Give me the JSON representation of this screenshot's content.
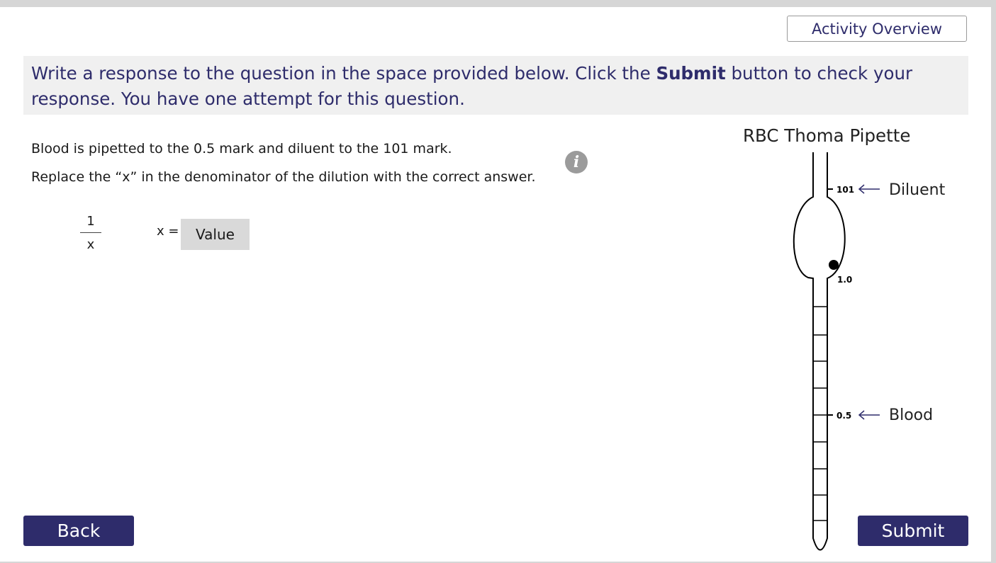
{
  "header": {
    "overview_label": "Activity Overview"
  },
  "instructions": {
    "before": "Write a response to the question in the space provided below. Click the ",
    "bold": "Submit",
    "after": " button to check your response. You have one attempt for this question."
  },
  "question": {
    "line1": "Blood is pipetted to the 0.5 mark and diluent to the 101 mark.",
    "line2": "Replace the “x” in the denominator of the dilution with the correct answer."
  },
  "fraction": {
    "numerator": "1",
    "denominator": "x"
  },
  "answer": {
    "label": "x =",
    "placeholder": "Value",
    "value": ""
  },
  "info_icon": {
    "glyph": "i",
    "icon": "info-icon"
  },
  "pipette": {
    "title": "RBC Thoma Pipette",
    "mark_101": "101",
    "mark_1_0": "1.0",
    "mark_0_5": "0.5",
    "diluent_label": "Diluent",
    "blood_label": "Blood"
  },
  "nav": {
    "back_label": "Back",
    "submit_label": "Submit"
  },
  "colors": {
    "accent": "#2e2c6b",
    "instruction_bg": "#f0f0f0",
    "input_bg": "#d9d9d9",
    "info_icon": "#9b9b9b"
  }
}
